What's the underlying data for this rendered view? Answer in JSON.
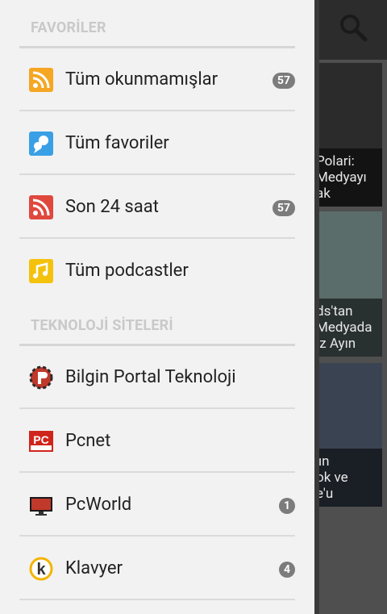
{
  "drawer": {
    "sections": [
      {
        "title": "FAVORİLER",
        "items": [
          {
            "label": "Tüm okunmamışlar",
            "icon": "rss-orange-icon",
            "badge": "57"
          },
          {
            "label": "Tüm favoriler",
            "icon": "favorites-icon",
            "badge": ""
          },
          {
            "label": "Son 24 saat",
            "icon": "rss-red-icon",
            "badge": "57"
          },
          {
            "label": "Tüm podcastler",
            "icon": "podcast-icon",
            "badge": ""
          }
        ]
      },
      {
        "title": "TEKNOLOJİ SİTELERİ",
        "items": [
          {
            "label": "Bilgin Portal Teknoloji",
            "icon": "bilgin-portal-logo-icon",
            "badge": ""
          },
          {
            "label": "Pcnet",
            "icon": "pcnet-logo-icon",
            "badge": ""
          },
          {
            "label": "PcWorld",
            "icon": "pcworld-monitor-icon",
            "badge": "1"
          },
          {
            "label": "Klavyer",
            "icon": "klavyer-logo-icon",
            "badge": "4"
          }
        ]
      }
    ]
  },
  "background": {
    "cards": [
      {
        "caption": "Polari:\nMedyayı\nak"
      },
      {
        "caption": "ds'tan\nMedyada\nız Ayın"
      },
      {
        "caption": "'ın\nok ve\ne'u"
      }
    ]
  },
  "colors": {
    "drawer_bg": "#f2f2f2",
    "section_header": "#c9c9c9",
    "badge_bg": "#7c7c7c",
    "rss_orange": "#f5a623",
    "rss_red": "#e0483e",
    "favorites_blue": "#3aa0e6",
    "podcast_yellow": "#f4c20d"
  }
}
